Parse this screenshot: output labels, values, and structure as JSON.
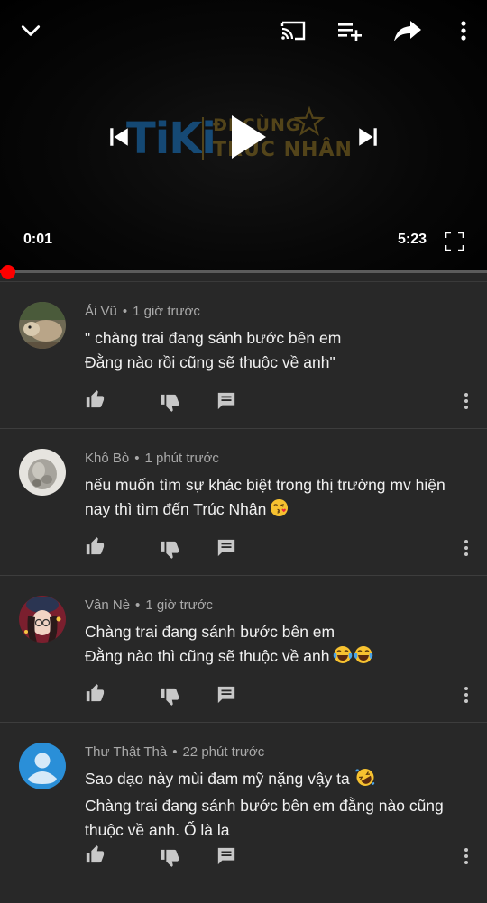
{
  "player": {
    "current_time": "0:01",
    "duration": "5:23",
    "progress": 0.003,
    "brand": {
      "logo_text": "TiKi",
      "tagline_line1": "ĐI CÙNG",
      "tagline_line2": "TRÚC NHÂN"
    },
    "icons": {
      "collapse": "chevron-down-icon",
      "cast": "cast-icon",
      "add_to_queue": "playlist-add-icon",
      "share": "share-icon",
      "more": "more-vert-icon",
      "previous": "skip-previous-icon",
      "play": "play-icon",
      "next": "skip-next-icon",
      "fullscreen": "fullscreen-icon"
    },
    "colors": {
      "progress": "#ff0000",
      "track": "#5c5c5c"
    }
  },
  "comments": [
    {
      "author": "Ái Vũ",
      "time": "1 giờ trước",
      "lines": [
        "\" chàng trai đang sánh bước bên em",
        "Đằng nào rồi cũng sẽ thuộc về anh\""
      ],
      "emoji": []
    },
    {
      "author": "Khô Bò",
      "time": "1 phút trước",
      "lines": [
        "nếu muốn tìm sự khác biệt trong thị trường mv hiện",
        "nay thì tìm đến Trúc Nhân"
      ],
      "emoji": [
        "kissing-face-emoji"
      ]
    },
    {
      "author": "Vân Nè",
      "time": "1 giờ trước",
      "lines": [
        "Chàng trai đang sánh bước bên em",
        "Đằng nào thì cũng sẽ thuộc về anh"
      ],
      "emoji": [
        "tears-of-joy-emoji",
        "tears-of-joy-emoji"
      ]
    },
    {
      "author": "Thư Thật Thà",
      "time": "22 phút trước",
      "lines": [
        "Sao dạo này mùi đam mỹ nặng vậy ta",
        "Chàng trai đang sánh bước bên em đằng nào cũng",
        "thuộc về anh. Ố là la"
      ],
      "emoji": [
        "rofl-emoji"
      ]
    }
  ],
  "comment_actions": {
    "like": "thumb-up-icon",
    "dislike": "thumb-down-icon",
    "reply": "reply-comment-icon",
    "menu": "more-vert-icon"
  }
}
